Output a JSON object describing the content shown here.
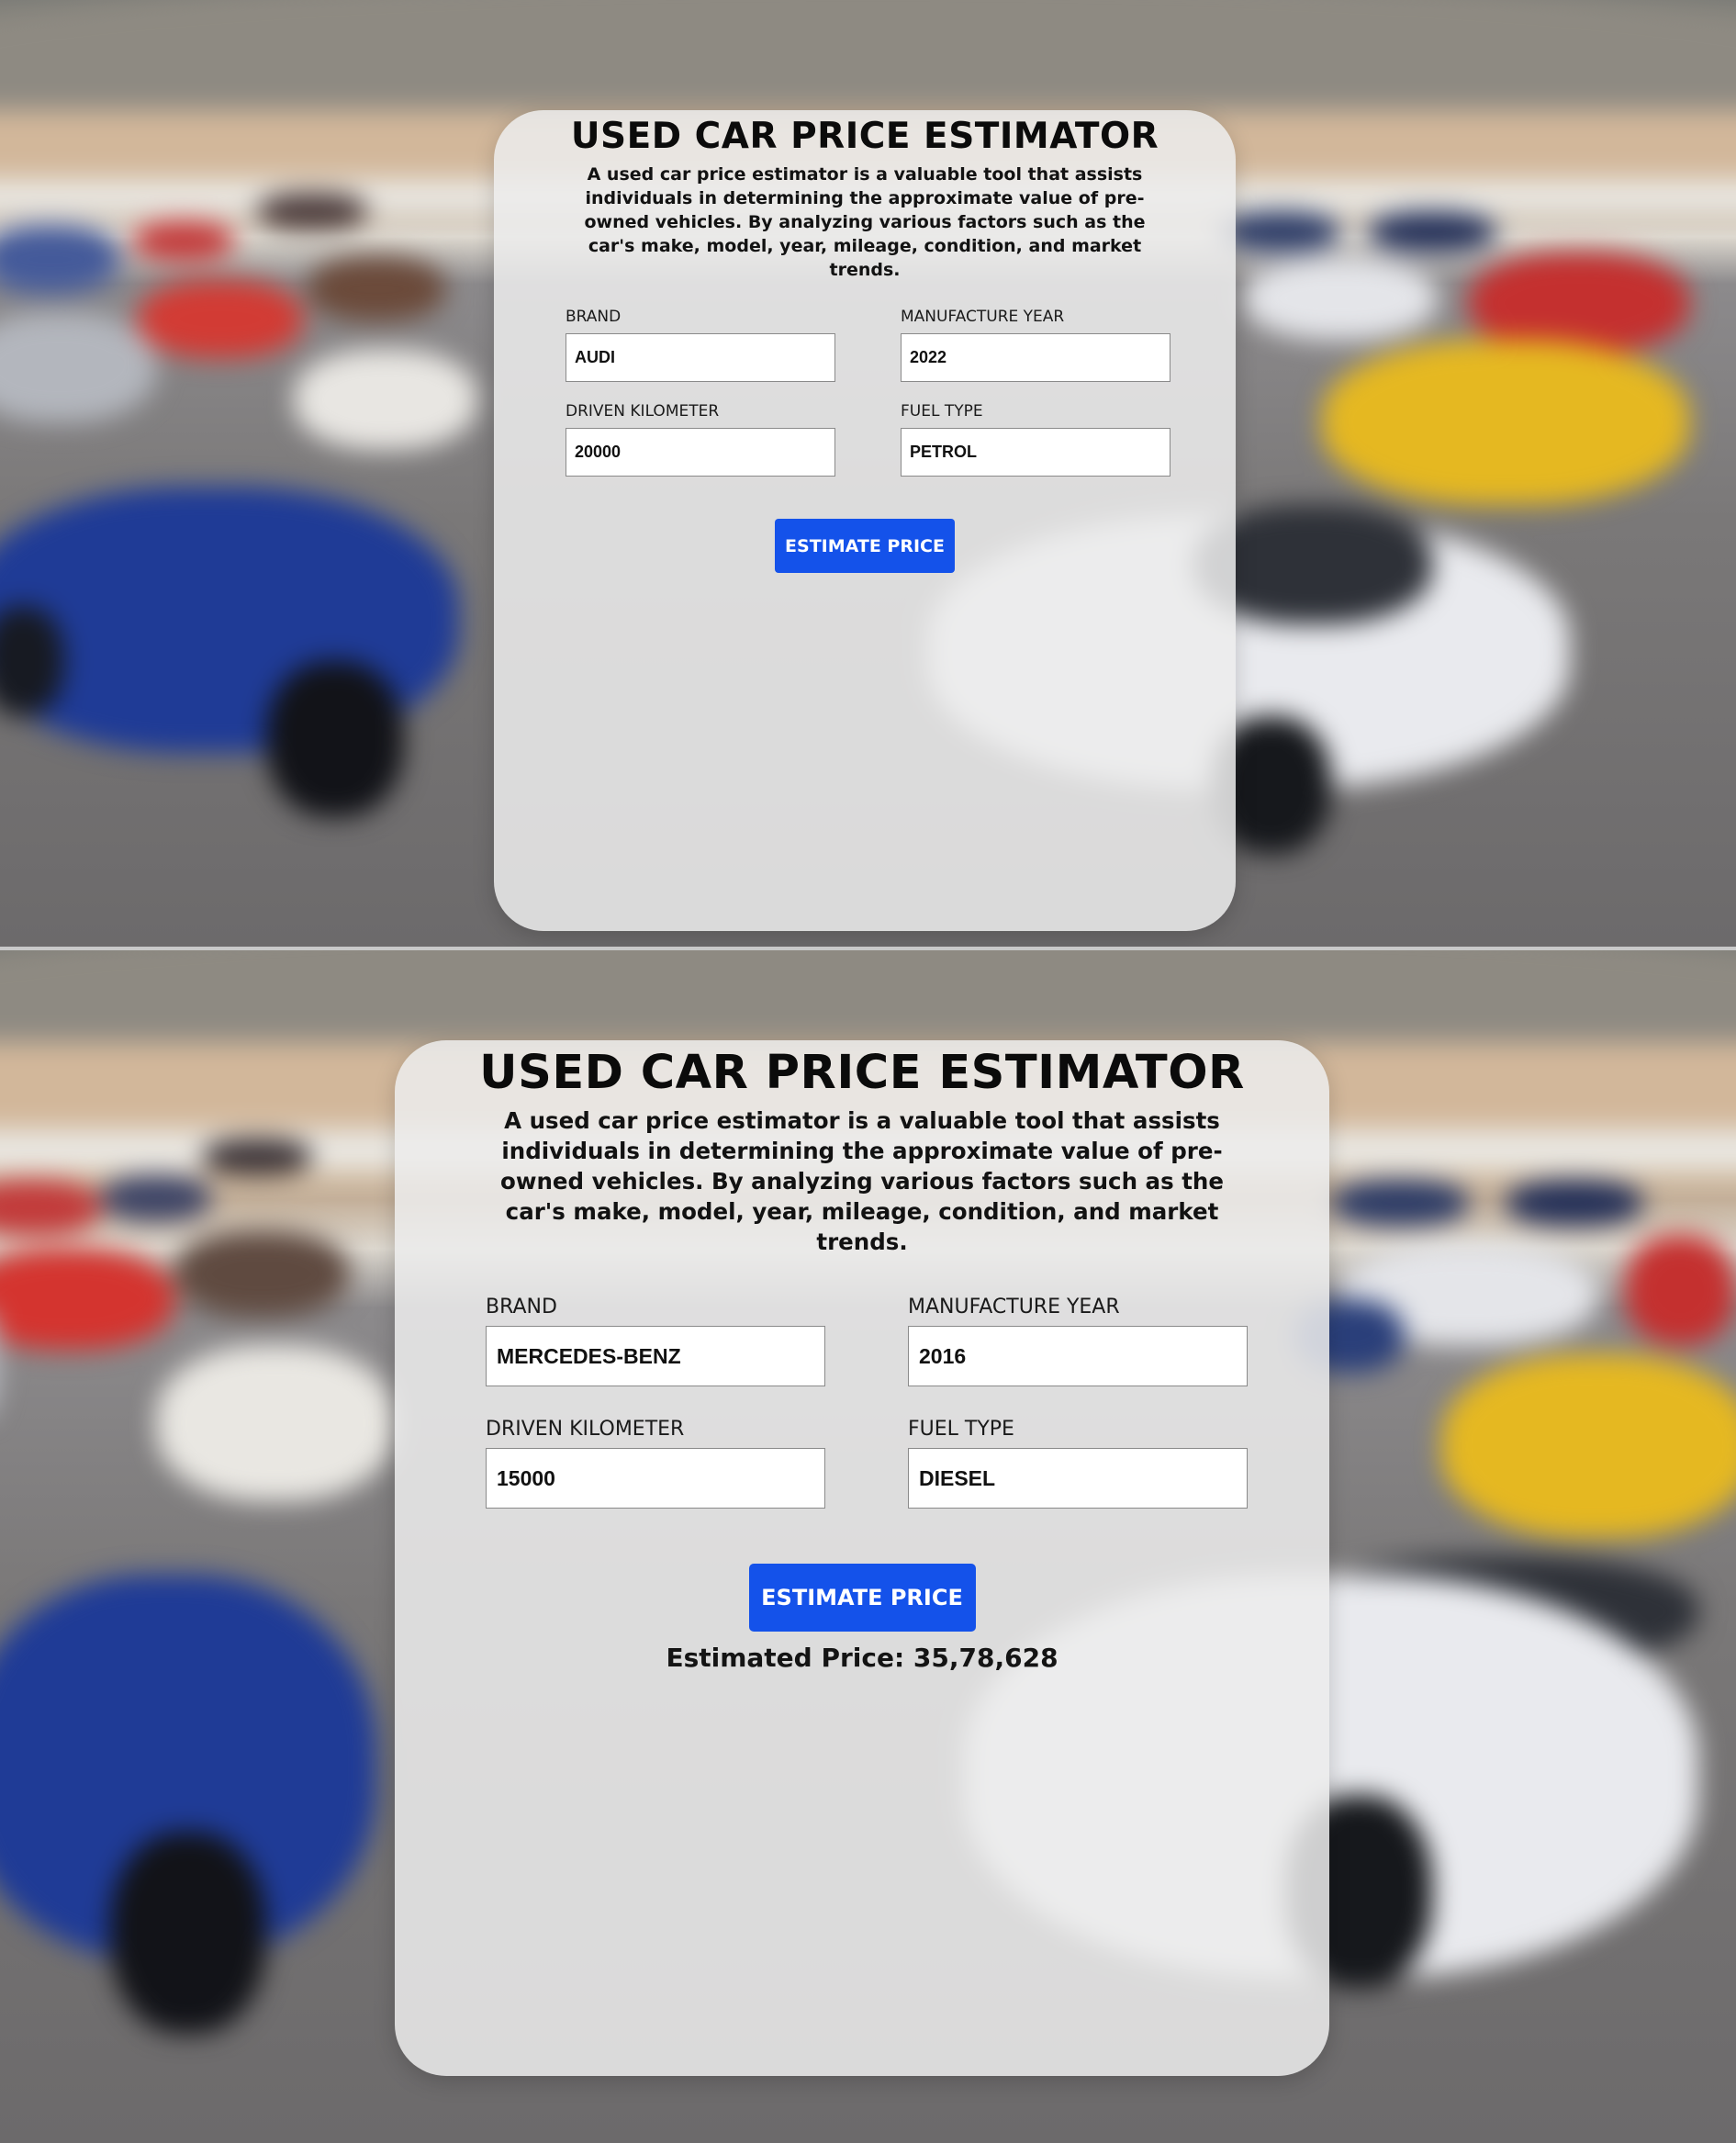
{
  "screens": [
    {
      "title": "USED CAR PRICE ESTIMATOR",
      "description": "A used car price estimator is a valuable tool that assists individuals in determining the approximate value of pre-owned vehicles. By analyzing various factors such as the car's make, model, year, mileage, condition, and market trends.",
      "fields": {
        "brand": {
          "label": "BRAND",
          "value": "AUDI"
        },
        "year": {
          "label": "MANUFACTURE YEAR",
          "value": "2022"
        },
        "km": {
          "label": "DRIVEN KILOMETER",
          "value": "20000"
        },
        "fuel": {
          "label": "FUEL TYPE",
          "value": "PETROL"
        }
      },
      "button_label": "ESTIMATE PRICE"
    },
    {
      "title": "USED CAR PRICE ESTIMATOR",
      "description": "A used car price estimator is a valuable tool that assists individuals in determining the approximate value of pre-owned vehicles. By analyzing various factors such as the car's make, model, year, mileage, condition, and market trends.",
      "fields": {
        "brand": {
          "label": "BRAND",
          "value": "MERCEDES-BENZ"
        },
        "year": {
          "label": "MANUFACTURE YEAR",
          "value": "2016"
        },
        "km": {
          "label": "DRIVEN KILOMETER",
          "value": "15000"
        },
        "fuel": {
          "label": "FUEL TYPE",
          "value": "DIESEL"
        }
      },
      "button_label": "ESTIMATE PRICE",
      "result": "Estimated Price: 35,78,628"
    }
  ],
  "colors": {
    "button": "#1452ea",
    "card": "rgba(236,236,236,0.86)"
  }
}
